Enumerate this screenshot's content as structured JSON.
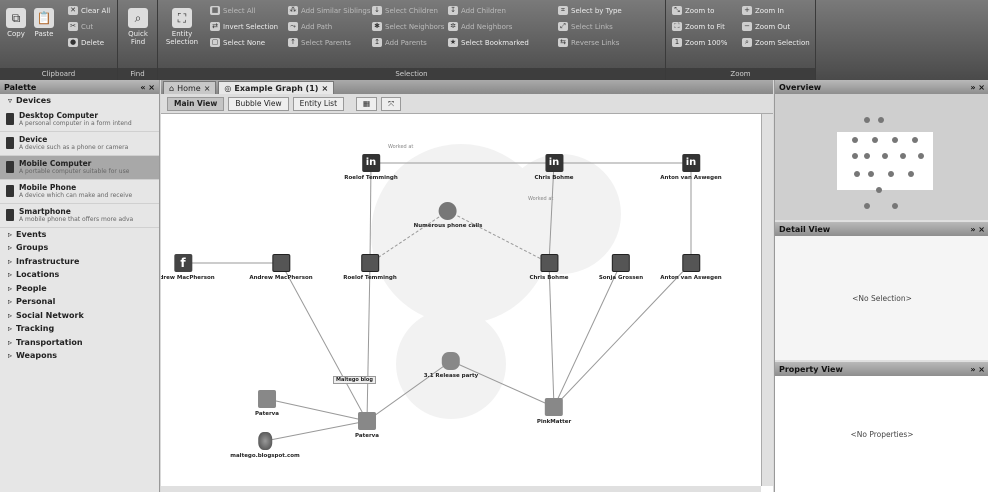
{
  "ribbon": {
    "clipboard": {
      "title": "Clipboard",
      "copy": "Copy",
      "paste": "Paste",
      "clear_all": "Clear All",
      "cut": "Cut",
      "delete": "Delete"
    },
    "find": {
      "title": "Find",
      "quick_find": "Quick Find"
    },
    "selection": {
      "title": "Selection",
      "entity_selection": "Entity Selection",
      "select_all": "Select All",
      "invert_selection": "Invert Selection",
      "select_none": "Select None",
      "add_similar_siblings": "Add Similar Siblings",
      "add_path": "Add Path",
      "select_parents": "Select Parents",
      "select_children": "Select Children",
      "select_neighbors": "Select Neighbors",
      "add_parents": "Add Parents",
      "add_children": "Add Children",
      "add_neighbors": "Add Neighbors",
      "select_bookmarked": "Select Bookmarked",
      "select_by_type": "Select by Type",
      "select_links": "Select Links",
      "reverse_links": "Reverse Links"
    },
    "zoom": {
      "title": "Zoom",
      "zoom_to": "Zoom to",
      "zoom_in": "Zoom In",
      "zoom_to_fit": "Zoom to Fit",
      "zoom_out": "Zoom Out",
      "zoom_100": "Zoom 100%",
      "zoom_selection": "Zoom Selection"
    }
  },
  "palette": {
    "title": "Palette",
    "open_category": "Devices",
    "entities": [
      {
        "name": "Desktop Computer",
        "desc": "A personal computer in a form intend"
      },
      {
        "name": "Device",
        "desc": "A device such as a phone or camera"
      },
      {
        "name": "Mobile Computer",
        "desc": "A portable computer suitable for use"
      },
      {
        "name": "Mobile Phone",
        "desc": "A device which can make and receive"
      },
      {
        "name": "Smartphone",
        "desc": "A mobile phone that offers more adva"
      }
    ],
    "categories": [
      "Events",
      "Groups",
      "Infrastructure",
      "Locations",
      "People",
      "Personal",
      "Social Network",
      "Tracking",
      "Transportation",
      "Weapons"
    ]
  },
  "tabs": [
    {
      "label": "Home"
    },
    {
      "label": "Example Graph (1)"
    }
  ],
  "views": {
    "main": "Main View",
    "bubble": "Bubble View",
    "entity_list": "Entity List"
  },
  "graph": {
    "nodes": [
      {
        "id": "li1",
        "label": "Roelof Temmingh"
      },
      {
        "id": "li2",
        "label": "Chris Bohme"
      },
      {
        "id": "li3",
        "label": "Anton van Aswegen"
      },
      {
        "id": "fb",
        "label": "Andrew MacPherson"
      },
      {
        "id": "p1",
        "label": "Andrew MacPherson"
      },
      {
        "id": "p2",
        "label": "Roelof Temmingh"
      },
      {
        "id": "p3",
        "label": "Chris Bohme"
      },
      {
        "id": "p4",
        "label": "Sonja Grossen"
      },
      {
        "id": "p5",
        "label": "Anton van Aswegen"
      },
      {
        "id": "calls",
        "label": "Numerous phone calls"
      },
      {
        "id": "party",
        "label": "3.1 Release party"
      },
      {
        "id": "paterva",
        "label": "Paterva"
      },
      {
        "id": "pinkmatter",
        "label": "PinkMatter"
      },
      {
        "id": "blogger",
        "label": "Paterva"
      },
      {
        "id": "blogsite",
        "label": "maltego.blogspot.com"
      }
    ],
    "link_labels": [
      "Worked at",
      "Worked at",
      "Maltego blog"
    ]
  },
  "overview": {
    "title": "Overview"
  },
  "detail": {
    "title": "Detail View",
    "empty": "<No Selection>"
  },
  "property": {
    "title": "Property View",
    "empty": "<No Properties>"
  }
}
